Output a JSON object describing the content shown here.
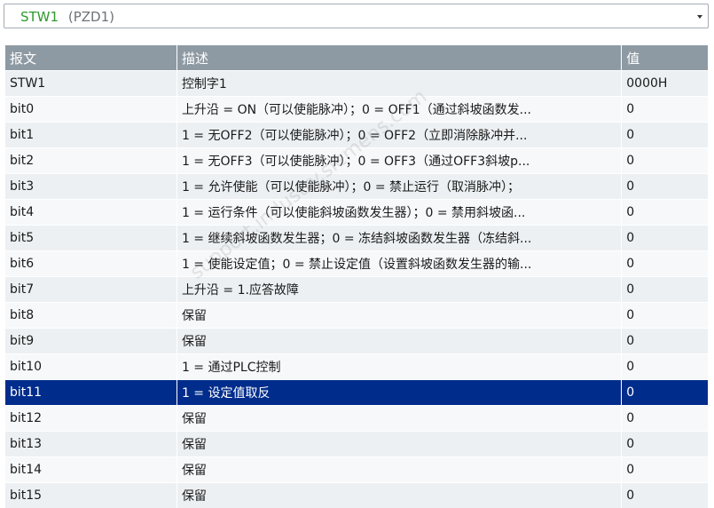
{
  "dropdown": {
    "name": "STW1",
    "subtitle": "(PZD1)"
  },
  "table": {
    "headers": [
      "报文",
      "描述",
      "值"
    ],
    "rows": [
      [
        "STW1",
        "控制字1",
        "0000H"
      ],
      [
        "bit0",
        "上升沿 = ON（可以使能脉冲）；0 = OFF1（通过斜坡函数发...",
        "0"
      ],
      [
        "bit1",
        "1 = 无OFF2（可以使能脉冲）；0 = OFF2（立即消除脉冲并...",
        "0"
      ],
      [
        "bit2",
        "1 = 无OFF3（可以使能脉冲）；0 = OFF3（通过OFF3斜坡p...",
        "0"
      ],
      [
        "bit3",
        "1 = 允许使能（可以使能脉冲）；0 = 禁止运行（取消脉冲）；",
        "0"
      ],
      [
        "bit4",
        "1 = 运行条件（可以使能斜坡函数发生器）；0 = 禁用斜坡函...",
        "0"
      ],
      [
        "bit5",
        "1 = 继续斜坡函数发生器；0 = 冻结斜坡函数发生器（冻结斜...",
        "0"
      ],
      [
        "bit6",
        "1 = 使能设定值；0 = 禁止设定值（设置斜坡函数发生器的输...",
        "0"
      ],
      [
        "bit7",
        "上升沿 = 1.应答故障",
        "0"
      ],
      [
        "bit8",
        "保留",
        "0"
      ],
      [
        "bit9",
        "保留",
        "0"
      ],
      [
        "bit10",
        "1 = 通过PLC控制",
        "0"
      ],
      [
        "bit11",
        "1 = 设定值取反",
        "0"
      ],
      [
        "bit12",
        "保留",
        "0"
      ],
      [
        "bit13",
        "保留",
        "0"
      ],
      [
        "bit14",
        "保留",
        "0"
      ],
      [
        "bit15",
        "保留",
        "0"
      ]
    ],
    "selected_row": "bit11"
  },
  "watermark": "support.industry.siemens.com",
  "colors": {
    "header_bg": "#8e9aa3",
    "selected_bg": "#002c8c",
    "dropdown_name": "#2e9a2e"
  },
  "icons": {
    "dropdown_arrow": "chevron-down-icon"
  }
}
